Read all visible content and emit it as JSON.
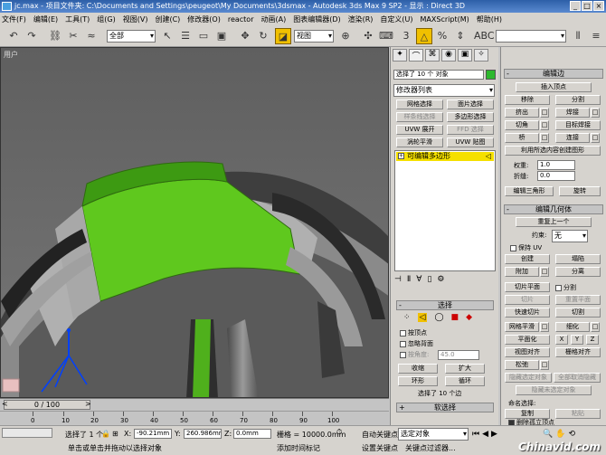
{
  "titlebar": {
    "title": "jc.max - 项目文件夹: C:\\Documents and Settings\\peugeot\\My Documents\\3dsmax - Autodesk 3ds Max 9 SP2 - 显示 : Direct 3D"
  },
  "menu": [
    "文件(F)",
    "编辑(E)",
    "工具(T)",
    "组(G)",
    "视图(V)",
    "创建(C)",
    "修改器(O)",
    "reactor",
    "动画(A)",
    "图表编辑器(D)",
    "渲染(R)",
    "自定义(U)",
    "MAXScript(M)",
    "帮助(H)"
  ],
  "toolbar": {
    "selection_filter": "全部",
    "coord_system": "视图"
  },
  "viewport": {
    "label": "用户"
  },
  "timeline": {
    "frame": "0 / 100",
    "ticks": [
      "0",
      "10",
      "20",
      "30",
      "40",
      "50",
      "60",
      "70",
      "80",
      "90",
      "100"
    ]
  },
  "status": {
    "selected": "选择了 1 个",
    "x_label": "X:",
    "x_val": "-90.21mm",
    "y_label": "Y:",
    "y_val": "260.986mm",
    "z_label": "Z:",
    "z_val": "0.0mm",
    "grid": "栅格 = 10000.0mm",
    "autokey": "自动关键点",
    "select_obj": "选定对象",
    "setkey": "设置关键点",
    "keyfilter": "关键点过滤器...",
    "prompt": "单击或单击并拖动以选择对象",
    "addtime": "添加时间标记",
    "watermark": "Chinavid.com"
  },
  "mid": {
    "selected": "选择了 10 个 对象",
    "modlist": "修改器列表",
    "buttons": [
      "网格选择",
      "面片选择",
      "样条线选择",
      "多边形选择",
      "UVW 展开",
      "FFD 选择",
      "涡轮平滑",
      "UVW 贴图"
    ],
    "stack_item": "可编辑多边形",
    "sel_title": "选择",
    "by_vertex": "按顶点",
    "ignore_back": "忽略背面",
    "by_angle": "按角度:",
    "angle_val": "45.0",
    "shrink": "收缩",
    "grow": "扩大",
    "ring": "环形",
    "loop": "循环",
    "sel_count": "选择了 10 个边",
    "soft_sel": "软选择"
  },
  "right": {
    "edit_edges": "编辑边",
    "insert_vertex": "插入顶点",
    "remove": "移除",
    "split": "分割",
    "extrude": "挤出",
    "weld": "焊接",
    "chamfer": "切角",
    "target_weld": "目标焊接",
    "bridge": "桥",
    "connect": "连接",
    "create_shape": "利用所选内容创建图形",
    "weight": "权重:",
    "weight_val": "1.0",
    "crease": "折缝:",
    "crease_val": "0.0",
    "edit_tri": "编辑三角形",
    "turn": "旋转",
    "edit_geo": "编辑几何体",
    "repeat_last": "重复上一个",
    "constraints": "约束:",
    "constraints_val": "无",
    "preserve_uv": "保持 UV",
    "create": "创建",
    "collapse": "塌陷",
    "attach": "附加",
    "detach": "分离",
    "slice_plane": "切片平面",
    "split2": "分割",
    "slice": "切片",
    "reset_plane": "重置平面",
    "quickslice": "快速切片",
    "cut": "切割",
    "meshsmooth": "网格平滑",
    "refine": "细化",
    "planarize": "平面化",
    "x": "X",
    "y": "Y",
    "z": "Z",
    "view_align": "视图对齐",
    "grid_align": "栅格对齐",
    "relax": "松弛",
    "hide_sel": "隐藏选定对象",
    "unhide_all": "全部取消隐藏",
    "hide_unsel": "隐藏未选定对象",
    "named_sel": "命名选择:",
    "copy": "复制",
    "paste": "粘贴",
    "delete_iso": "删除孤立顶点"
  }
}
